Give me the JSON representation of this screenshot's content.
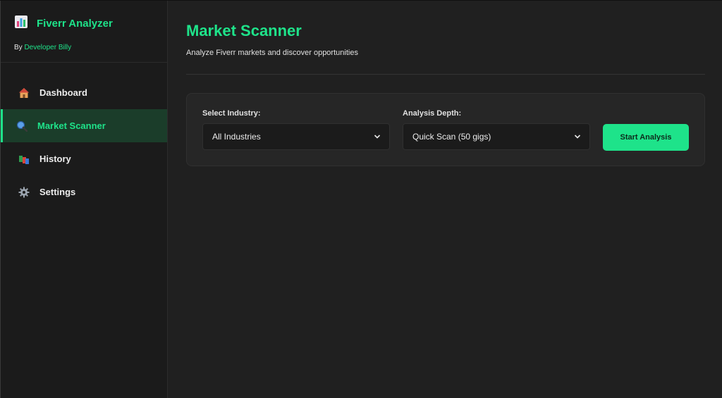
{
  "sidebar": {
    "brand": {
      "title": "Fiverr Analyzer",
      "by": "By",
      "developer": "Developer Billy"
    },
    "items": [
      {
        "label": "Dashboard",
        "icon": "house-icon",
        "active": false
      },
      {
        "label": "Market Scanner",
        "icon": "magnifier-icon",
        "active": true
      },
      {
        "label": "History",
        "icon": "books-icon",
        "active": false
      },
      {
        "label": "Settings",
        "icon": "gear-icon",
        "active": false
      }
    ]
  },
  "main": {
    "title": "Market Scanner",
    "subtitle": "Analyze Fiverr markets and discover opportunities",
    "industry": {
      "label": "Select Industry:",
      "value": "All Industries"
    },
    "depth": {
      "label": "Analysis Depth:",
      "value": "Quick Scan (50 gigs)"
    },
    "start_label": "Start Analysis"
  },
  "colors": {
    "accent": "#1ee38a",
    "background": "#202020",
    "sidebar": "#1b1b1b",
    "active_bg": "#1b3d2a"
  }
}
